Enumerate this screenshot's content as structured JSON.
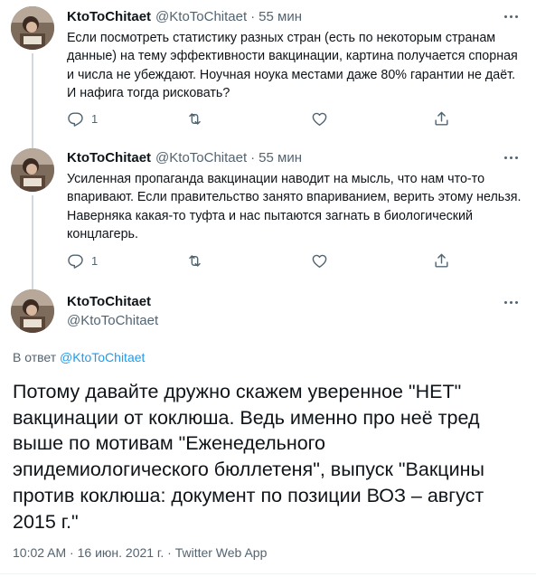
{
  "tweets": [
    {
      "name": "KtoToChitaet",
      "handle": "@KtoToChitaet",
      "separator": "·",
      "time": "55 мин",
      "text": "Если посмотреть статистику разных стран (есть по некоторым странам\nданные) на тему эффективности вакцинации, картина получается спорная\nи числа не убеждают. Ноучная ноука местами даже 80% гарантии не даёт.\nИ нафига тогда рисковать?",
      "reply_count": "1"
    },
    {
      "name": "KtoToChitaet",
      "handle": "@KtoToChitaet",
      "separator": "·",
      "time": "55 мин",
      "text": "Усиленная пропаганда вакцинации наводит на мысль, что нам что-то\nвпаривают. Если правительство занято впариванием, верить этому нельзя.\nНаверняка какая-то туфта и нас пытаются загнать в биологический\nконцлагерь.",
      "reply_count": "1"
    }
  ],
  "main_tweet": {
    "name": "KtoToChitaet",
    "handle": "@KtoToChitaet",
    "reply_prefix": "В ответ",
    "reply_handle": "@KtoToChitaet",
    "text": "Потому давайте дружно скажем уверенное \"НЕТ\"\nвакцинации от коклюша. Ведь именно про неё тред\nвыше по мотивам \"Еженедельного\nэпидемиологического бюллетеня\", выпуск \"Вакцины\nпротив коклюша: документ по позиции ВОЗ – август\n2015 г.\"",
    "time": "10:02 AM",
    "separator": "·",
    "date": "16 июн. 2021 г.",
    "source": "Twitter Web App"
  },
  "icons": {
    "reply": "reply-icon",
    "retweet": "retweet-icon",
    "like": "like-icon",
    "share": "share-icon",
    "more": "more-icon",
    "avatar": "avatar-image"
  },
  "colors": {
    "text": "#0f1419",
    "secondary": "#536471",
    "link": "#1d9bf0",
    "thread_line": "#cfd9de",
    "divider": "#eff3f4"
  }
}
